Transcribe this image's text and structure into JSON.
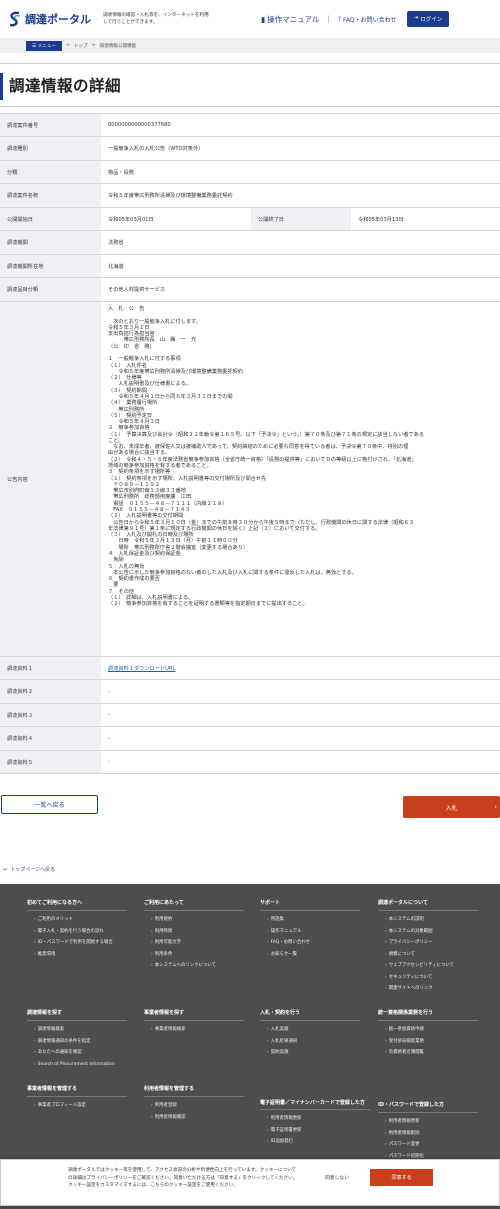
{
  "header": {
    "logo_text": "調達ポータル",
    "description": "調達情報の確認・入札等を、インターネットを利用して行うことができます。",
    "manual": "操作マニュアル",
    "faq": "FAQ・お問い合わせ",
    "login": "ログイン"
  },
  "breadcrumb": {
    "menu": "メニュー",
    "top": "トップ",
    "sep": ">",
    "current": "調達情報公開機能"
  },
  "page_title": "調達情報の詳細",
  "fields": {
    "case_no_label": "調達案件番号",
    "case_no": "0000000000000377680",
    "type_label": "調達種別",
    "type": "一般競争入札の入札公告（WTO対象外）",
    "category_label": "分類",
    "category": "物品・役務",
    "name_label": "調達案件名称",
    "name": "令和５年度帯広刑務所清掃及び環境整備業務委託契約",
    "start_label": "公開開始日",
    "start": "令和05年03月01日",
    "end_label": "公開終了日",
    "end": "令和05年03月13日",
    "agency_label": "調達機関",
    "agency": "法務省",
    "location_label": "調達機関所在地",
    "location": "北海道",
    "item_label": "調達品目分類",
    "item": "その他人材提供サービス",
    "notice_label": "公告内容",
    "notice": "入　札　公　告\n\n　次のとおり一般競争入札に付します。\n令和５年３月１日\n支出負担行為担当官\n　　　帯広刑務所長　山　縣　一　光\n（公　印　省　略）\n\n１　一般競争入札に付する事項\n（１）　入札件名\n　　令和５年度帯広刑務所清掃及び環境整備業務委託契約\n（２）　仕様等\n　　入札説明書及び仕様書による。\n（３）　契約期間\n　　令和５年４月１日から同６年３月３１日までの間\n（４）　業務履行場所\n　　帯広刑務所\n（５）　契約予定日\n　　令和５年４月３日\n２　競争参加資格\n（１）　予算決算及び会計令（昭和２２年勅令第１６５号。以下「予決令」という。）第７０条及び第７１条の規定に該当しない者である\nこと。\n　なお、未成年者、被保佐人又は被補助人であって、契約締結のために必要な同意を得ている者は、予決令第７０条中、特別の理\n由がある場合に該当する。\n（２）　令和４・５・６年度法務省競争参加資格（全省庁統一資格）「役務の提供等」においてＤの等級以上に格付けされ、「北海道」\n地域の競争参加資格を有する者であること。\n３　契約条項を示す場所等\n（１）　契約条項を示す場所、入札説明書等の交付場所及び問合せ先\n　〒０８９－１１９２\n　帯広市別府町南１３線３３番地\n　帯広刑務所　総務部用度課　江田\n　電話　０１５５－４８－７１１１（内線２１８）\n　FAX　０１５５－４８－７１４３\n（２）　入札説明書等の交付期間\n　公告日から令和５年３月１０日（金）までの午前８時３０分から午後５時まで（ただし、行政機関の休日に関する法律（昭和６３\n年法律第９１号）第１条に規定する行政機関の休日を除く）上記（１）において交付する。\n（３）　入札及び開札の日時及び場所\n　　日時　令和５年３月１３日（月）午前１１時００分\n　　場所　帯広刑務所庁舎２階会議室（変更する場合あり）\n４　入札保証金及び契約保証金\n　免除\n５　入札の無効\n　本公告に示した競争参加資格のない者のした入札及び入札に関する条件に違反した入札は、無効とする。\n６　契約書作成の要否\n　要\n７　その他\n（１）　詳細は、入札説明書による。\n（２）　競争参加資格を有することを証明する書類等を指定期日までに提出すること。",
    "doc1_label": "調達資料１",
    "doc1": "調達資料１ダウンロードURL",
    "doc2_label": "調達資料２",
    "doc2": "-",
    "doc3_label": "調達資料３",
    "doc3": "-",
    "doc4_label": "調達資料４",
    "doc4": "-",
    "doc5_label": "調達資料５",
    "doc5": "-"
  },
  "buttons": {
    "back": "一覧へ戻る",
    "bid": "入札",
    "top": "トップページへ戻る"
  },
  "footer": {
    "beginners": {
      "title": "初めてご利用になる方へ",
      "items": [
        "ご利用のメリット",
        "電子入札・契約を行う場合の流れ",
        "ID・パスワードで利用を開始する場合",
        "推奨環境"
      ]
    },
    "usage": {
      "title": "ご利用にあたって",
      "items": [
        "利用規約",
        "利用時間",
        "利用可能文字",
        "利用条件",
        "本システムへのリンクについて"
      ]
    },
    "support": {
      "title": "サポート",
      "items": [
        "用語集",
        "操作マニュアル",
        "FAQ・お問い合わせ",
        "お知らせ一覧"
      ]
    },
    "about": {
      "title": "調達ポータルについて",
      "items": [
        "本システムの説明",
        "本システムの対象範囲",
        "プライバシーポリシー",
        "規模について",
        "ウェブアクセシビリティについて",
        "セキュリティについて",
        "関連サイトへのリンク"
      ]
    },
    "search": {
      "title": "調達情報を探す",
      "items": [
        "調達情報検索",
        "調達情報通知の条件を指定",
        "あなたへの通知を確認",
        "Search of Procurement Information"
      ]
    },
    "vendor_search": {
      "title": "事業者情報を探す",
      "items": [
        "事業者情報検索"
      ]
    },
    "bid": {
      "title": "入札・契約を行う",
      "items": [
        "入札実施",
        "入札結果通知",
        "契約実施"
      ]
    },
    "unified": {
      "title": "統一資格関係業務を行う",
      "items": [
        "統一参加資格申請",
        "受付部局検索業務",
        "有資格者名簿閲覧"
      ]
    },
    "vendor_manage": {
      "title": "事業者情報を管理する",
      "items": [
        "事業者プロフィール設定"
      ]
    },
    "user_manage": {
      "title": "利用者情報を管理する",
      "items": [
        "利用者登録",
        "利用者情報確認"
      ]
    },
    "mynumber": {
      "title": "電子証明書／マイナンバーカードで登録した方",
      "items": [
        "利用者情報更新",
        "電子証明書更新",
        "ID追加発行"
      ]
    },
    "idpw": {
      "title": "ID・パスワードで登録した方",
      "items": [
        "利用者情報更新",
        "利用者情報削除",
        "パスワード変更",
        "パスワード初期化"
      ]
    }
  },
  "cookie": {
    "text": "調達ポータルではクッキー等を使用して、アクセス状況の分析や利便性向上を行っています。クッキーについての詳細はプライバシーポリシーをご確認ください。同意いただける方は「同意する」をクリックしてください。クッキー設定をカスタマイズするには、こちらのクッキー設定をご使用ください。",
    "deny": "同意しない",
    "accept": "同意する"
  },
  "colors": {
    "brand": "#1c3d8f",
    "accent": "#c8401b",
    "footer": "#4d4d4d"
  }
}
